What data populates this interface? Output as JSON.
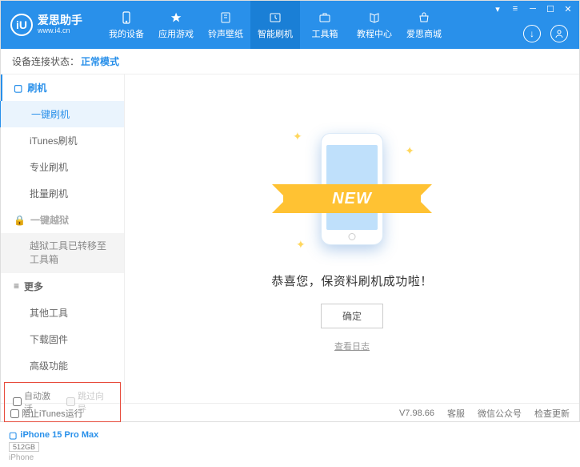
{
  "header": {
    "logo_letter": "iU",
    "title": "爱思助手",
    "url": "www.i4.cn",
    "nav": [
      {
        "label": "我的设备"
      },
      {
        "label": "应用游戏"
      },
      {
        "label": "铃声壁纸"
      },
      {
        "label": "智能刷机"
      },
      {
        "label": "工具箱"
      },
      {
        "label": "教程中心"
      },
      {
        "label": "爱思商城"
      }
    ]
  },
  "status": {
    "label": "设备连接状态：",
    "mode": "正常模式"
  },
  "sidebar": {
    "flash_title": "刷机",
    "items_flash": [
      "一键刷机",
      "iTunes刷机",
      "专业刷机",
      "批量刷机"
    ],
    "jailbreak_title": "一键越狱",
    "jailbreak_note": "越狱工具已转移至工具箱",
    "more_title": "更多",
    "items_more": [
      "其他工具",
      "下载固件",
      "高级功能"
    ],
    "cb_auto": "自动激活",
    "cb_skip": "跳过向导",
    "device_name": "iPhone 15 Pro Max",
    "device_storage": "512GB",
    "device_type": "iPhone"
  },
  "main": {
    "ribbon": "NEW",
    "message": "恭喜您，保资料刷机成功啦！",
    "ok": "确定",
    "log": "查看日志"
  },
  "footer": {
    "block_itunes": "阻止iTunes运行",
    "version": "V7.98.66",
    "links": [
      "客服",
      "微信公众号",
      "检查更新"
    ]
  }
}
